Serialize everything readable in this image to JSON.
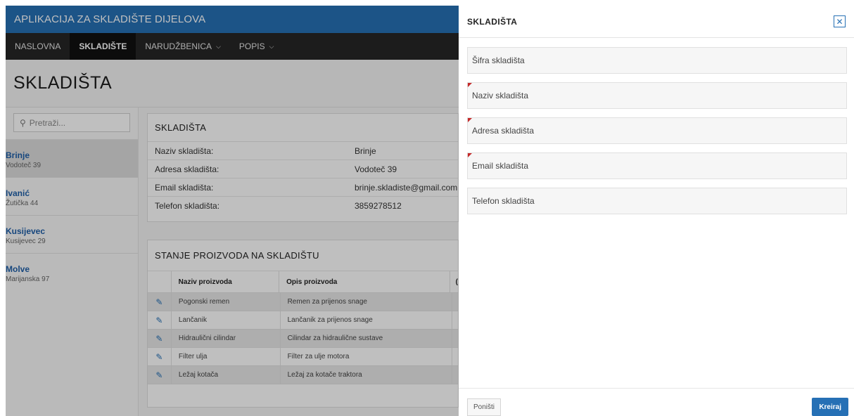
{
  "app": {
    "title": "APLIKACIJA ZA SKLADIŠTE DIJELOVA"
  },
  "nav": {
    "items": [
      {
        "label": "NASLOVNA"
      },
      {
        "label": "SKLADIŠTE"
      },
      {
        "label": "NARUDŽBENICA"
      },
      {
        "label": "POPIS"
      }
    ]
  },
  "page": {
    "title": "SKLADIŠTA"
  },
  "search": {
    "placeholder": "Pretraži..."
  },
  "warehouses": [
    {
      "name": "Brinje",
      "address": "Vodoteč 39"
    },
    {
      "name": "Ivanić",
      "address": "Žutička 44"
    },
    {
      "name": "Kusijevec",
      "address": "Kusijevec 29"
    },
    {
      "name": "Molve",
      "address": "Marijanska 97"
    }
  ],
  "details": {
    "title": "SKLADIŠTA",
    "rows": [
      {
        "label": "Naziv skladišta:",
        "value": "Brinje"
      },
      {
        "label": "Adresa skladišta:",
        "value": "Vodoteč 39"
      },
      {
        "label": "Email skladišta:",
        "value": "brinje.skladiste@gmail.com"
      },
      {
        "label": "Telefon skladišta:",
        "value": "3859278512"
      }
    ]
  },
  "stock": {
    "title": "STANJE PROIZVODA NA SKLADIŠTU",
    "headers": [
      "Naziv proizvoda",
      "Opis proizvoda",
      "("
    ],
    "rows": [
      {
        "name": "Pogonski remen",
        "desc": "Remen za prijenos snage",
        "extra": ""
      },
      {
        "name": "Lančanik",
        "desc": "Lančanik za prijenos snage",
        "extra": ""
      },
      {
        "name": "Hidraulični cilindar",
        "desc": "Cilindar za hidraulične sustave",
        "extra": ""
      },
      {
        "name": "Filter ulja",
        "desc": "Filter za ulje motora",
        "extra": ""
      },
      {
        "name": "Ležaj kotača",
        "desc": "Ležaj za kotače traktora",
        "extra": ""
      }
    ]
  },
  "dialog": {
    "title": "SKLADIŠTA",
    "fields": [
      {
        "label": "Šifra skladišta",
        "required": false
      },
      {
        "label": "Naziv skladišta",
        "required": true
      },
      {
        "label": "Adresa skladišta",
        "required": true
      },
      {
        "label": "Email skladišta",
        "required": true
      },
      {
        "label": "Telefon skladišta",
        "required": false
      }
    ],
    "cancel_label": "Poništi",
    "create_label": "Kreiraj"
  },
  "colors": {
    "accent": "#2670b5",
    "navbar": "#262626",
    "required_marker": "#c42a2a"
  },
  "icons": {
    "search": "search-icon",
    "edit": "edit-icon",
    "close": "close-icon",
    "chevron": "chevron-down-icon"
  }
}
